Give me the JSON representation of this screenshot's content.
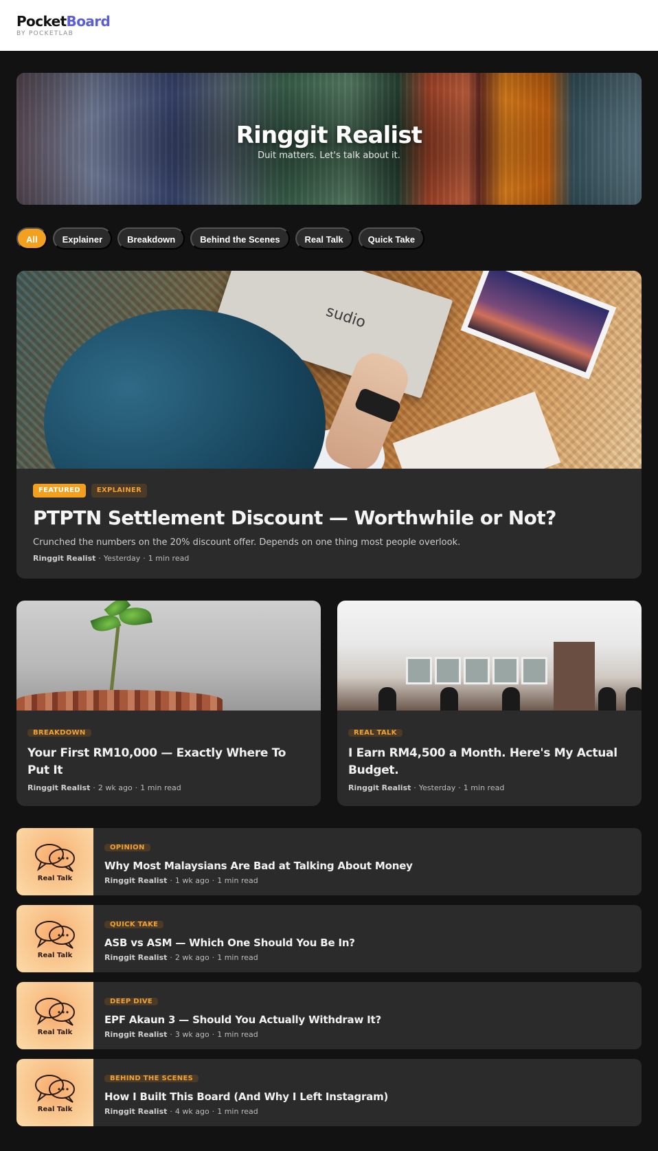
{
  "brand": {
    "name_part1": "Pocket",
    "name_part2": "Board",
    "byline": "BY POCKETLAB",
    "accent_color": "#5a5fd6"
  },
  "hero": {
    "title": "Ringgit Realist",
    "subtitle": "Duit matters. Let's talk about it."
  },
  "filters": {
    "items": [
      "All",
      "Explainer",
      "Breakdown",
      "Behind the Scenes",
      "Real Talk",
      "Quick Take"
    ],
    "active": "All",
    "active_color": "#f2a01e"
  },
  "featured": {
    "tag_primary": "FEATURED",
    "tag_secondary": "EXPLAINER",
    "image_text": "sudio",
    "title": "PTPTN Settlement Discount — Worthwhile or Not?",
    "description": "Crunched the numbers on the 20% discount offer. Depends on one thing most people overlook.",
    "author": "Ringgit Realist",
    "time": "Yesterday",
    "read": "1 min read"
  },
  "cards": [
    {
      "tag": "BREAKDOWN",
      "title": "Your First RM10,000 — Exactly Where To Put It",
      "author": "Ringgit Realist",
      "time": "2 wk ago",
      "read": "1 min read"
    },
    {
      "tag": "REAL TALK",
      "title": "I Earn RM4,500 a Month. Here's My Actual Budget.",
      "author": "Ringgit Realist",
      "time": "Yesterday",
      "read": "1 min read"
    }
  ],
  "list": [
    {
      "thumb_label": "Real Talk",
      "tag": "OPINION",
      "title": "Why Most Malaysians Are Bad at Talking About Money",
      "author": "Ringgit Realist",
      "time": "1 wk ago",
      "read": "1 min read"
    },
    {
      "thumb_label": "Real Talk",
      "tag": "QUICK TAKE",
      "title": "ASB vs ASM — Which One Should You Be In?",
      "author": "Ringgit Realist",
      "time": "2 wk ago",
      "read": "1 min read"
    },
    {
      "thumb_label": "Real Talk",
      "tag": "DEEP DIVE",
      "title": "EPF Akaun 3 — Should You Actually Withdraw It?",
      "author": "Ringgit Realist",
      "time": "3 wk ago",
      "read": "1 min read"
    },
    {
      "thumb_label": "Real Talk",
      "tag": "BEHIND THE SCENES",
      "title": "How I Built This Board (And Why I Left Instagram)",
      "author": "Ringgit Realist",
      "time": "4 wk ago",
      "read": "1 min read"
    }
  ],
  "separator": "·"
}
